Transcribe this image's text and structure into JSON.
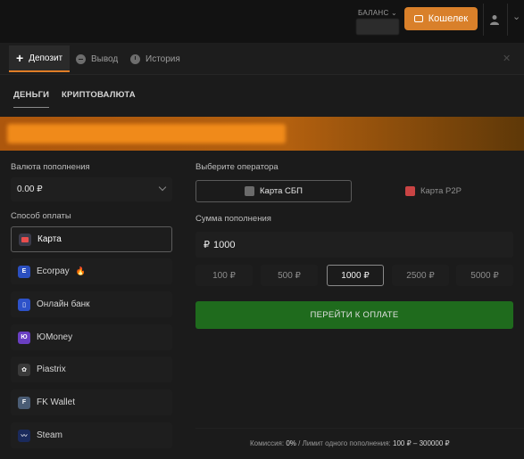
{
  "topbar": {
    "balance_label": "БАЛАНС",
    "wallet_label": "Кошелек",
    "accent": "#d9802a"
  },
  "tabs": [
    {
      "label": "Депозит",
      "icon": "plus-icon"
    },
    {
      "label": "Вывод",
      "icon": "minus-circle-icon"
    },
    {
      "label": "История",
      "icon": "clock-icon"
    }
  ],
  "subtabs": [
    {
      "label": "ДЕНЬГИ"
    },
    {
      "label": "КРИПТОВАЛЮТА"
    }
  ],
  "deposit": {
    "currency_label": "Валюта пополнения",
    "currency_value": "0.00 ₽",
    "method_label": "Способ оплаты",
    "methods": [
      {
        "label": "Карта",
        "icon": "card-icon",
        "color": "#3b3b4a"
      },
      {
        "label": "Ecorpay",
        "icon": "ecorpay-icon",
        "color": "#2b4fbf",
        "badge": "🔥"
      },
      {
        "label": "Онлайн банк",
        "icon": "bank-icon",
        "color": "#2d52c9"
      },
      {
        "label": "ЮMoney",
        "icon": "yumoney-icon",
        "color": "#6a3fc2"
      },
      {
        "label": "Piastrix",
        "icon": "piastrix-icon",
        "color": "#3a3a3a"
      },
      {
        "label": "FK Wallet",
        "icon": "fk-wallet-icon",
        "color": "#4a5c74"
      },
      {
        "label": "Steam",
        "icon": "steam-icon",
        "color": "#1a2a5c"
      }
    ],
    "operator_label": "Выберите оператора",
    "operators": [
      {
        "label": "Карта СБП",
        "icon": "sbp-icon"
      },
      {
        "label": "Карта P2P",
        "icon": "p2p-icon"
      }
    ],
    "amount_label": "Сумма пополнения",
    "currency_symbol": "₽",
    "amount_value": "1000",
    "presets": [
      "100 ₽",
      "500 ₽",
      "1000 ₽",
      "2500 ₽",
      "5000 ₽"
    ],
    "pay_label": "ПЕРЕЙТИ К ОПЛАТЕ",
    "pay_color": "#1f6b1d",
    "footer": {
      "commission_label": "Комиссия:",
      "commission_value": "0%",
      "sep": "/",
      "limit_label": "Лимит одного пополнения:",
      "limit_value": "100 ₽ – 300000 ₽"
    }
  }
}
